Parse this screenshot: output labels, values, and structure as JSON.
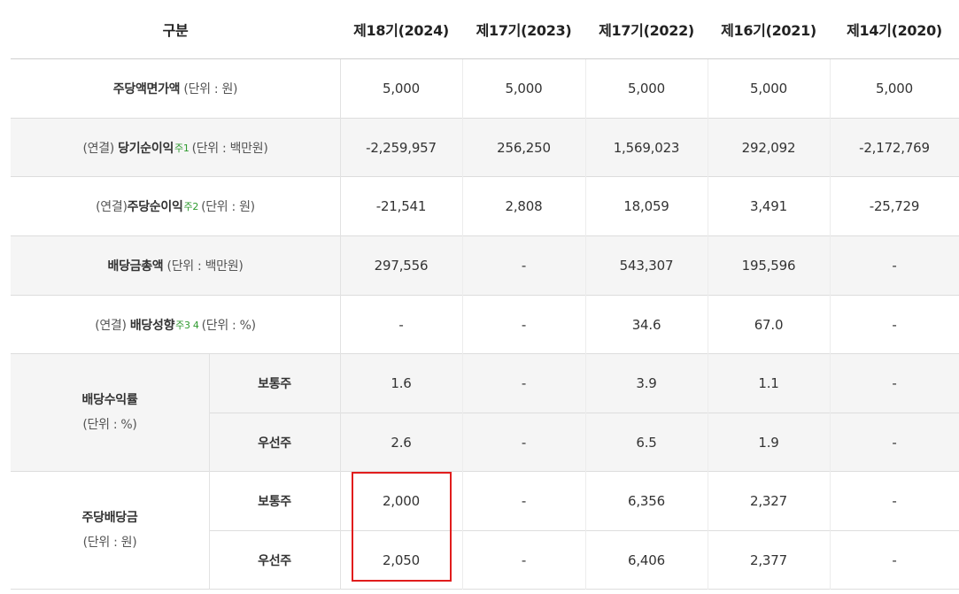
{
  "header": {
    "category": "구분",
    "periods": [
      "제18기(2024)",
      "제17기(2023)",
      "제17기(2022)",
      "제16기(2021)",
      "제14기(2020)"
    ]
  },
  "rows": {
    "par_value": {
      "label": "주당액면가액",
      "unit": "(단위 : 원)",
      "values": [
        "5,000",
        "5,000",
        "5,000",
        "5,000",
        "5,000"
      ]
    },
    "net_income": {
      "prefix": "(연결)",
      "label": "당기순이익",
      "note": "주1",
      "unit": "(단위 : 백만원)",
      "values": [
        "-2,259,957",
        "256,250",
        "1,569,023",
        "292,092",
        "-2,172,769"
      ]
    },
    "eps": {
      "prefix": "(연결)",
      "label": "주당순이익",
      "note": "주2",
      "unit": "(단위 : 원)",
      "values": [
        "-21,541",
        "2,808",
        "18,059",
        "3,491",
        "-25,729"
      ]
    },
    "total_dividend": {
      "label": "배당금총액",
      "unit": "(단위 : 백만원)",
      "values": [
        "297,556",
        "-",
        "543,307",
        "195,596",
        "-"
      ]
    },
    "payout_ratio": {
      "prefix": "(연결)",
      "label": "배당성향",
      "note": "주3 4",
      "unit": "(단위 : %)",
      "values": [
        "-",
        "-",
        "34.6",
        "67.0",
        "-"
      ]
    },
    "dividend_yield": {
      "label": "배당수익률",
      "unit": "(단위 : %)",
      "common": {
        "label": "보통주",
        "values": [
          "1.6",
          "-",
          "3.9",
          "1.1",
          "-"
        ]
      },
      "preferred": {
        "label": "우선주",
        "values": [
          "2.6",
          "-",
          "6.5",
          "1.9",
          "-"
        ]
      }
    },
    "dps": {
      "label": "주당배당금",
      "unit": "(단위 : 원)",
      "common": {
        "label": "보통주",
        "values": [
          "2,000",
          "-",
          "6,356",
          "2,327",
          "-"
        ]
      },
      "preferred": {
        "label": "우선주",
        "values": [
          "2,050",
          "-",
          "6,406",
          "2,377",
          "-"
        ]
      }
    }
  },
  "colors": {
    "highlight_border": "#e11d1d",
    "note_green": "#2e9a2e",
    "row_shade": "#f5f5f5",
    "grid_line": "#dddddd"
  }
}
